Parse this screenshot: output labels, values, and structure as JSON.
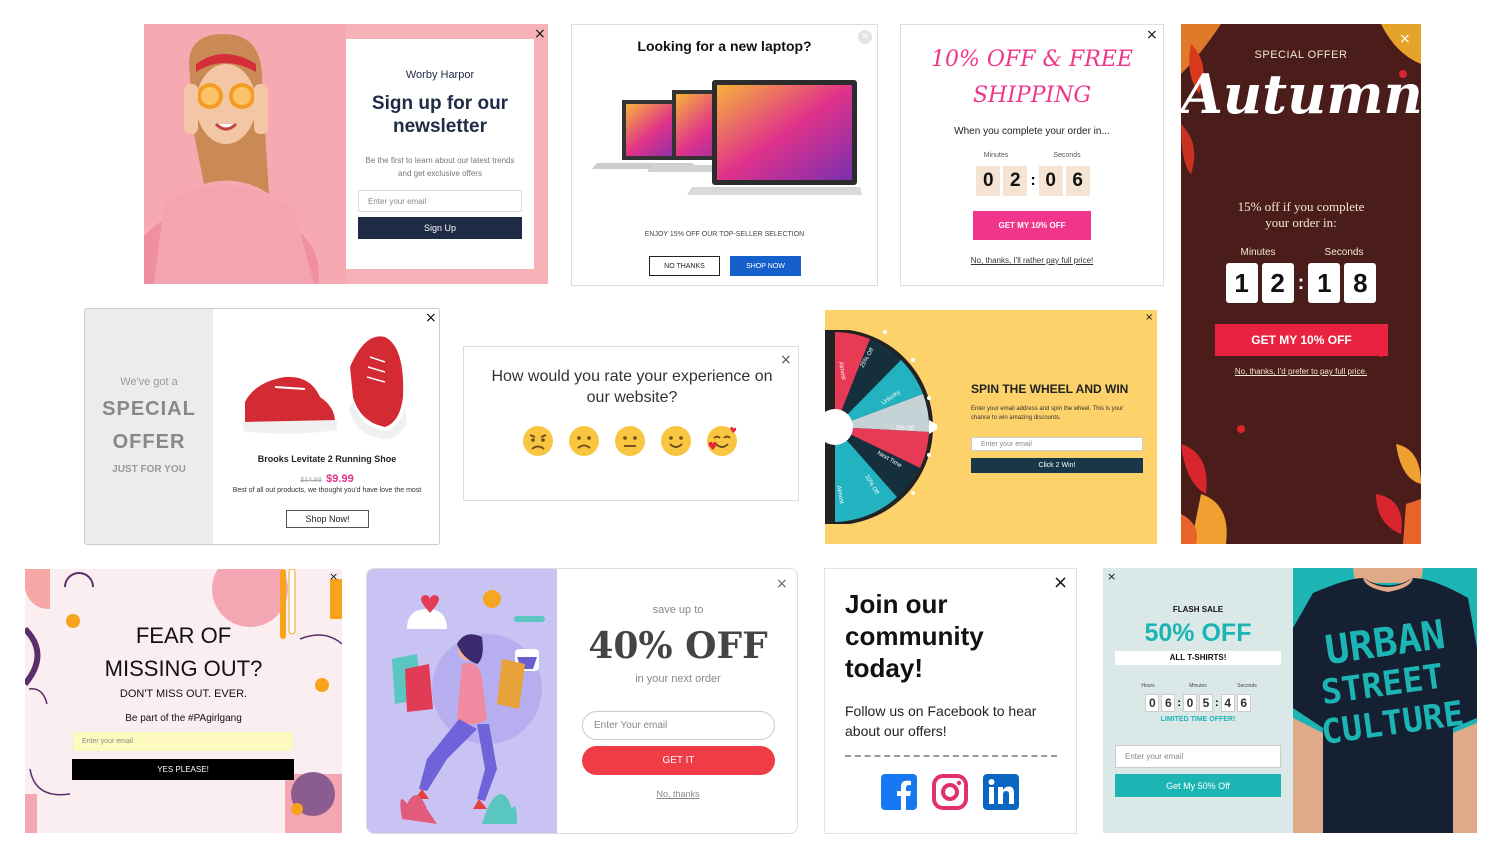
{
  "p1": {
    "brand": "Worby Harpor",
    "title": "Sign up for our newsletter",
    "desc": "Be the first to learn about our latest trends and get exclusive offers",
    "placeholder": "Enter your email",
    "button": "Sign Up",
    "close": "×"
  },
  "p2": {
    "title": "Looking for a new laptop?",
    "subtitle": "ENJOY 15% OFF OUR TOP-SELLER SELECTION",
    "no_button": "NO THANKS",
    "shop_button": "SHOP NOW"
  },
  "p3": {
    "title_line1": "10% OFF & FREE",
    "title_line2": "SHIPPING",
    "subtitle": "When you complete your order in...",
    "min_label": "Minutes",
    "sec_label": "Seconds",
    "digits": [
      "0",
      "2",
      "0",
      "6"
    ],
    "sep": ":",
    "button": "GET MY 10% OFF",
    "decline": "No, thanks, I'll rather pay full price!",
    "close": "×",
    "accent": "#f0358a"
  },
  "p4": {
    "label": "SPECIAL OFFER",
    "title": "Autumn",
    "subtitle_line1": "15% off if you complete",
    "subtitle_line2": "your order in:",
    "min_label": "Minutes",
    "sec_label": "Seconds",
    "digits": [
      "1",
      "2",
      "1",
      "8"
    ],
    "sep": ":",
    "button": "GET MY 10% OFF",
    "decline": "No, thanks, I'd prefer to pay full price.",
    "close": "×",
    "bg": "#4a1c1a",
    "accent": "#e8223f"
  },
  "p5": {
    "line1": "We've got a",
    "line2": "SPECIAL",
    "line3": "OFFER",
    "line4": "JUST FOR YOU",
    "product": "Brooks Levitate 2 Running Shoe",
    "old_price": "$14.99",
    "price": "$9.99",
    "desc": "Best of all out products, we thought you'd have love the most",
    "button": "Shop Now!",
    "close": "×"
  },
  "p6": {
    "question": "How would you rate your experience on our website?",
    "close": "×",
    "emojis": [
      "angry-emoji",
      "frowning-emoji",
      "neutral-emoji",
      "smiling-emoji",
      "love-emoji"
    ]
  },
  "p7": {
    "title": "SPIN THE WHEEL AND WIN",
    "desc": "Enter your email address and spin the wheel. This is your chance to win amazing discounts.",
    "placeholder": "Enter your email",
    "button": "Click 2 Win!",
    "close": "×",
    "segments": [
      "Almost",
      "25% Off",
      "Unlucky",
      "5% Off",
      "Next Time",
      "10% Off",
      "Almost"
    ]
  },
  "p8": {
    "title_line1": "FEAR OF",
    "title_line2": "MISSING OUT?",
    "subtitle": "DON'T MISS OUT. EVER.",
    "tagline": "Be part of the #PAgirlgang",
    "placeholder": "Enter your email",
    "button": "YES PLEASE!",
    "close": "×"
  },
  "p9": {
    "pre": "save up to",
    "headline": "40% OFF",
    "post": "in your next order",
    "placeholder": "Enter Your email",
    "button": "GET IT",
    "decline": "No, thanks",
    "close": "×"
  },
  "p10": {
    "title_line1": "Join our",
    "title_line2": "community",
    "title_line3": "today!",
    "desc": "Follow us on Facebook to hear about our offers!",
    "close": "×",
    "icons": [
      "facebook-icon",
      "instagram-icon",
      "linkedin-icon"
    ]
  },
  "p11": {
    "label": "FLASH SALE",
    "headline": "50% OFF",
    "sub": "ALL T-SHIRTS!",
    "hours_label": "Hours",
    "min_label": "Minutes",
    "sec_label": "Seconds",
    "digits": [
      "0",
      "6",
      "0",
      "5",
      "4",
      "6"
    ],
    "sep": ":",
    "limited": "LIMITED TIME OFFER!",
    "placeholder": "Enter your email",
    "button": "Get My 50% Off",
    "close": "×",
    "shirt_text": [
      "URBAN",
      "STREET",
      "CULTURE"
    ]
  }
}
